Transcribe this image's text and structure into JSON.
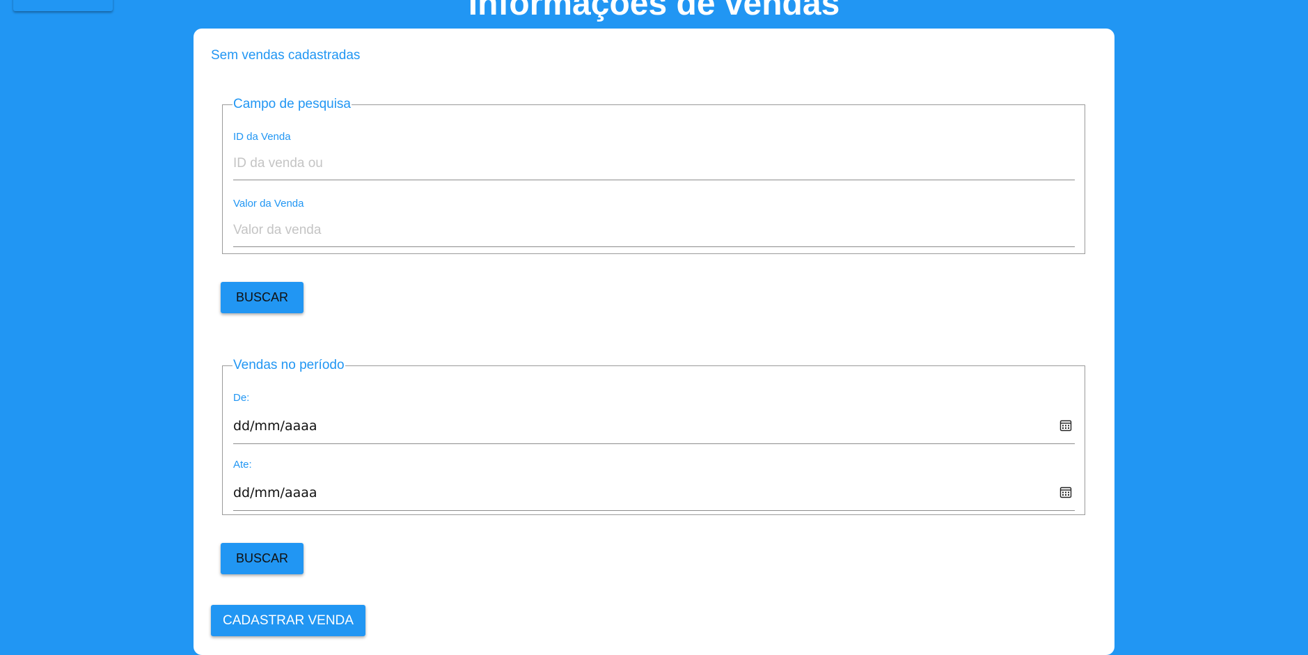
{
  "page": {
    "title": "Informações de vendas",
    "empty_message": "Sem vendas cadastradas"
  },
  "search_section": {
    "legend": "Campo de pesquisa",
    "id_label": "ID da Venda",
    "id_placeholder": "ID da venda ou",
    "value_label": "Valor da Venda",
    "value_placeholder": "Valor da venda",
    "button_label": "BUSCAR"
  },
  "period_section": {
    "legend": "Vendas no período",
    "from_label": "De:",
    "from_value": "dd/mm/aaaa",
    "to_label": "Ate:",
    "to_value": "dd/mm/aaaa",
    "button_label": "BUSCAR"
  },
  "actions": {
    "register_label": "CADASTRAR VENDA"
  },
  "colors": {
    "primary": "#2196f3",
    "card_background": "#ffffff"
  }
}
